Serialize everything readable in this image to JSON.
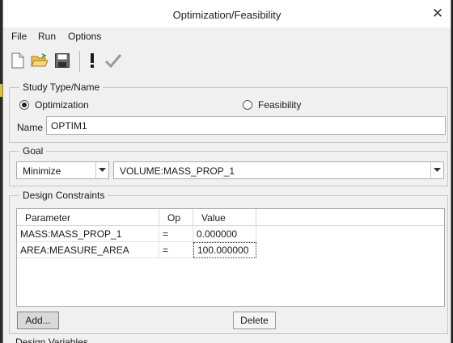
{
  "window": {
    "title": "Optimization/Feasibility"
  },
  "menubar": {
    "items": [
      "File",
      "Run",
      "Options"
    ]
  },
  "toolbar": {
    "icons": [
      "new-document-icon",
      "open-folder-icon",
      "save-icon",
      "run-icon",
      "accept-icon"
    ]
  },
  "study": {
    "group_label": "Study Type/Name",
    "option_optimization": "Optimization",
    "option_feasibility": "Feasibility",
    "selected": "Optimization",
    "name_label": "Name",
    "name_value": "OPTIM1"
  },
  "goal": {
    "group_label": "Goal",
    "direction": "Minimize",
    "parameter": "VOLUME:MASS_PROP_1"
  },
  "constraints": {
    "group_label": "Design Constraints",
    "columns": [
      "Parameter",
      "Op",
      "Value"
    ],
    "rows": [
      {
        "parameter": "MASS:MASS_PROP_1",
        "op": "=",
        "value": "0.000000"
      },
      {
        "parameter": "AREA:MEASURE_AREA",
        "op": "=",
        "value": "100.000000"
      }
    ],
    "add_label": "Add...",
    "delete_label": "Delete"
  },
  "next_group": {
    "label": "Design Variables"
  },
  "colors": {
    "accent_checked": "#222222",
    "window_bg": "#f0f0f0",
    "edge_highlight": "#d8c23a"
  }
}
